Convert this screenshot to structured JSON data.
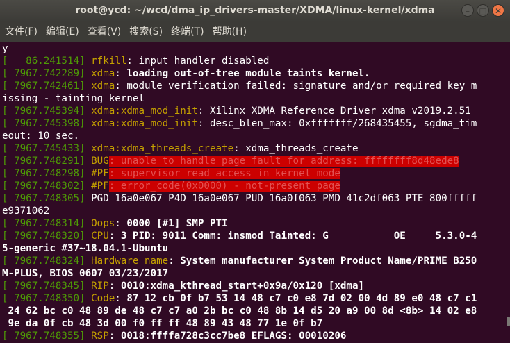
{
  "window": {
    "title": "root@ycd: ~/wcd/dma_ip_drivers-master/XDMA/linux-kernel/xdma",
    "minimize_glyph": "–",
    "maximize_glyph": "□",
    "close_glyph": "✕"
  },
  "menu": [
    "文件(F)",
    "编辑(E)",
    "查看(V)",
    "搜索(S)",
    "终端(T)",
    "帮助(H)"
  ],
  "colors": {
    "background": "#300a24",
    "timestamp": "#4e9a06",
    "prefix": "#c4a000",
    "highlight": "#cc0000"
  },
  "lines": [
    [
      {
        "t": "y",
        "c": ""
      }
    ],
    [
      {
        "t": "[   86.241514] ",
        "c": "ts"
      },
      {
        "t": "rfkill",
        "c": "yl"
      },
      {
        "t": ": input handler disabled",
        "c": ""
      }
    ],
    [
      {
        "t": "[ 7967.742289] ",
        "c": "ts"
      },
      {
        "t": "xdma",
        "c": "yl"
      },
      {
        "t": ": ",
        "c": ""
      },
      {
        "t": "loading out-of-tree module taints kernel.",
        "c": "b"
      }
    ],
    [
      {
        "t": "[ 7967.742461] ",
        "c": "ts"
      },
      {
        "t": "xdma",
        "c": "yl"
      },
      {
        "t": ": module verification failed: signature and/or required key m",
        "c": ""
      }
    ],
    [
      {
        "t": "issing - tainting kernel",
        "c": ""
      }
    ],
    [
      {
        "t": "[ 7967.745394] ",
        "c": "ts"
      },
      {
        "t": "xdma:xdma_mod_init",
        "c": "yl"
      },
      {
        "t": ": Xilinx XDMA Reference Driver xdma v2019.2.51",
        "c": ""
      }
    ],
    [
      {
        "t": "[ 7967.745398] ",
        "c": "ts"
      },
      {
        "t": "xdma:xdma_mod_init",
        "c": "yl"
      },
      {
        "t": ": desc_blen_max: 0xfffffff/268435455, sgdma_tim",
        "c": ""
      }
    ],
    [
      {
        "t": "eout: 10 sec.",
        "c": ""
      }
    ],
    [
      {
        "t": "[ 7967.745433] ",
        "c": "ts"
      },
      {
        "t": "xdma:xdma_threads_create",
        "c": "yl"
      },
      {
        "t": ": xdma_threads_create",
        "c": ""
      }
    ],
    [
      {
        "t": "[ 7967.748291] ",
        "c": "ts"
      },
      {
        "t": "BUG",
        "c": "yl"
      },
      {
        "t": ": unable to handle page fault for address: ffffffff8d48ede8",
        "c": "red"
      }
    ],
    [
      {
        "t": "[ 7967.748298] ",
        "c": "ts"
      },
      {
        "t": "#PF",
        "c": "yl"
      },
      {
        "t": ": supervisor read access in kernel mode",
        "c": "red"
      }
    ],
    [
      {
        "t": "[ 7967.748302] ",
        "c": "ts"
      },
      {
        "t": "#PF",
        "c": "yl"
      },
      {
        "t": ": error_code(0x0000) - not-present page",
        "c": "red"
      }
    ],
    [
      {
        "t": "[ 7967.748305] ",
        "c": "ts"
      },
      {
        "t": "PGD 16a0e067 P4D 16a0e067 PUD 16a0f063 PMD 41c2df063 PTE 800fffff",
        "c": ""
      }
    ],
    [
      {
        "t": "e9371062",
        "c": ""
      }
    ],
    [
      {
        "t": "[ 7967.748314] ",
        "c": "ts"
      },
      {
        "t": "Oops",
        "c": "yl"
      },
      {
        "t": ": ",
        "c": ""
      },
      {
        "t": "0000 [#1] SMP PTI",
        "c": "b"
      }
    ],
    [
      {
        "t": "[ 7967.748320] ",
        "c": "ts"
      },
      {
        "t": "CPU",
        "c": "yl"
      },
      {
        "t": ": ",
        "c": ""
      },
      {
        "t": "3 PID: 9011 Comm: insmod Tainted: G           OE     5.3.0-4",
        "c": "b"
      }
    ],
    [
      {
        "t": "5-generic #37~18.04.1-Ubuntu",
        "c": "b"
      }
    ],
    [
      {
        "t": "[ 7967.748324] ",
        "c": "ts"
      },
      {
        "t": "Hardware name",
        "c": "yl"
      },
      {
        "t": ": ",
        "c": ""
      },
      {
        "t": "System manufacturer System Product Name/PRIME B250",
        "c": "b"
      }
    ],
    [
      {
        "t": "M-PLUS, BIOS 0607 03/23/2017",
        "c": "b"
      }
    ],
    [
      {
        "t": "[ 7967.748345] ",
        "c": "ts"
      },
      {
        "t": "RIP",
        "c": "yl"
      },
      {
        "t": ": ",
        "c": ""
      },
      {
        "t": "0010:xdma_kthread_start+0x9a/0x120 [xdma]",
        "c": "b"
      }
    ],
    [
      {
        "t": "[ 7967.748350] ",
        "c": "ts"
      },
      {
        "t": "Code",
        "c": "yl"
      },
      {
        "t": ": ",
        "c": ""
      },
      {
        "t": "87 12 cb 0f b7 53 14 48 c7 c0 e8 7d 02 00 4d 89 e0 48 c7 c1",
        "c": "b"
      }
    ],
    [
      {
        "t": " 24 62 bc c0 48 89 de 48 c7 c7 a0 2b bc c0 48 8b 14 d5 20 a9 00 8d <8b> 14 02 e8",
        "c": "b"
      }
    ],
    [
      {
        "t": " 9e da 0f cb 48 3d 00 f0 ff ff 48 89 43 48 77 1e 0f b7",
        "c": "b"
      }
    ],
    [
      {
        "t": "[ 7967.748355] ",
        "c": "ts"
      },
      {
        "t": "RSP",
        "c": "yl"
      },
      {
        "t": ": ",
        "c": ""
      },
      {
        "t": "0018:ffffa728c3cc7be8 EFLAGS: 00010206",
        "c": "b"
      }
    ]
  ]
}
